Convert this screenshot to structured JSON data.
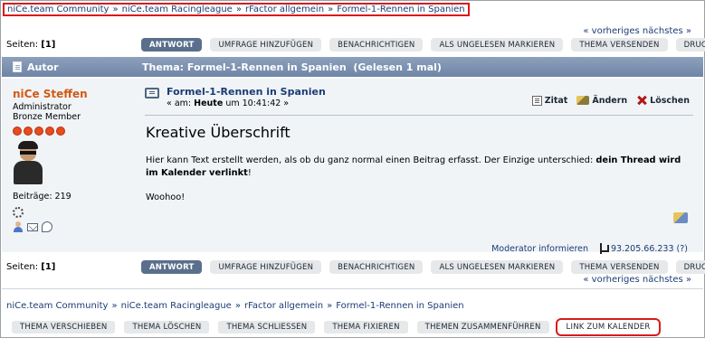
{
  "breadcrumb": [
    "niCe.team Community",
    "niCe.team Racingleague",
    "rFactor allgemein",
    "Formel-1-Rennen in Spanien"
  ],
  "breadcrumb_sep": "»",
  "prevnext": "« vorheriges nächstes »",
  "pages": {
    "label": "Seiten:",
    "value": "[1]"
  },
  "buttons": [
    "ANTWORT",
    "UMFRAGE HINZUFÜGEN",
    "BENACHRICHTIGEN",
    "ALS UNGELESEN MARKIEREN",
    "THEMA VERSENDEN",
    "DRUCKEN"
  ],
  "header": {
    "author": "Autor",
    "topic": "Thema: Formel-1-Rennen in Spanien  (Gelesen 1 mal)"
  },
  "poster": {
    "name": "niCe Steffen",
    "role": "Administrator",
    "rank": "Bronze Member",
    "stars": 5,
    "posts": "Beiträge: 219"
  },
  "post": {
    "subject": "Formel-1-Rennen in Spanien",
    "date_prefix": "« am:",
    "date_bold": "Heute",
    "date_suffix": "um 10:41:42 »",
    "actions": {
      "quote": "Zitat",
      "edit": "Ändern",
      "delete": "Löschen"
    },
    "heading": "Kreative Überschrift",
    "text_plain": "Hier kann Text erstellt werden, als ob du ganz normal einen Beitrag erfasst. Der Einzige unterschied: ",
    "text_bold": "dein Thread wird im Kalender verlinkt",
    "text_end": "!",
    "woohoo": "Woohoo!",
    "moderator": "Moderator informieren",
    "ip": "93.205.66.233 (?)"
  },
  "mod_buttons": [
    "THEMA VERSCHIEBEN",
    "THEMA LÖSCHEN",
    "THEMA SCHLIESSEN",
    "THEMA FIXIEREN",
    "THEMEN ZUSAMMENFÜHREN",
    "LINK ZUM KALENDER"
  ],
  "colors": {
    "link": "#1b3c75",
    "header": "#7a8fb0",
    "name": "#d25a13",
    "highlight": "#d81b1b"
  }
}
